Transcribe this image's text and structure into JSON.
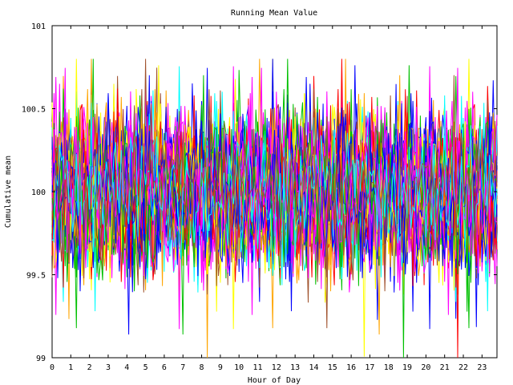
{
  "chart_data": {
    "type": "line",
    "title": "Running Mean Value",
    "xlabel": "Hour of Day",
    "ylabel": "Cumulative mean",
    "xlim": [
      0,
      23.8
    ],
    "ylim": [
      99,
      101
    ],
    "x_ticks": [
      "0",
      "1",
      "2",
      "3",
      "4",
      "5",
      "6",
      "7",
      "8",
      "9",
      "10",
      "11",
      "12",
      "13",
      "14",
      "15",
      "16",
      "17",
      "18",
      "19",
      "20",
      "21",
      "22",
      "23"
    ],
    "y_ticks": [
      "99",
      "99.5",
      "100",
      "100.5",
      "101"
    ],
    "grid": false,
    "legend": "none",
    "samples_per_hour": 10,
    "series_count": 56,
    "series_mean": 100.0,
    "series_typical_range": [
      99.6,
      100.45
    ],
    "series_extreme_range": [
      99.0,
      100.8
    ],
    "colors": [
      "#ff0000",
      "#00c000",
      "#0000ff",
      "#ff00ff",
      "#00ffff",
      "#a0522d",
      "#ffa500",
      "#ffff00",
      "#ff00ff",
      "#0000ff"
    ]
  }
}
